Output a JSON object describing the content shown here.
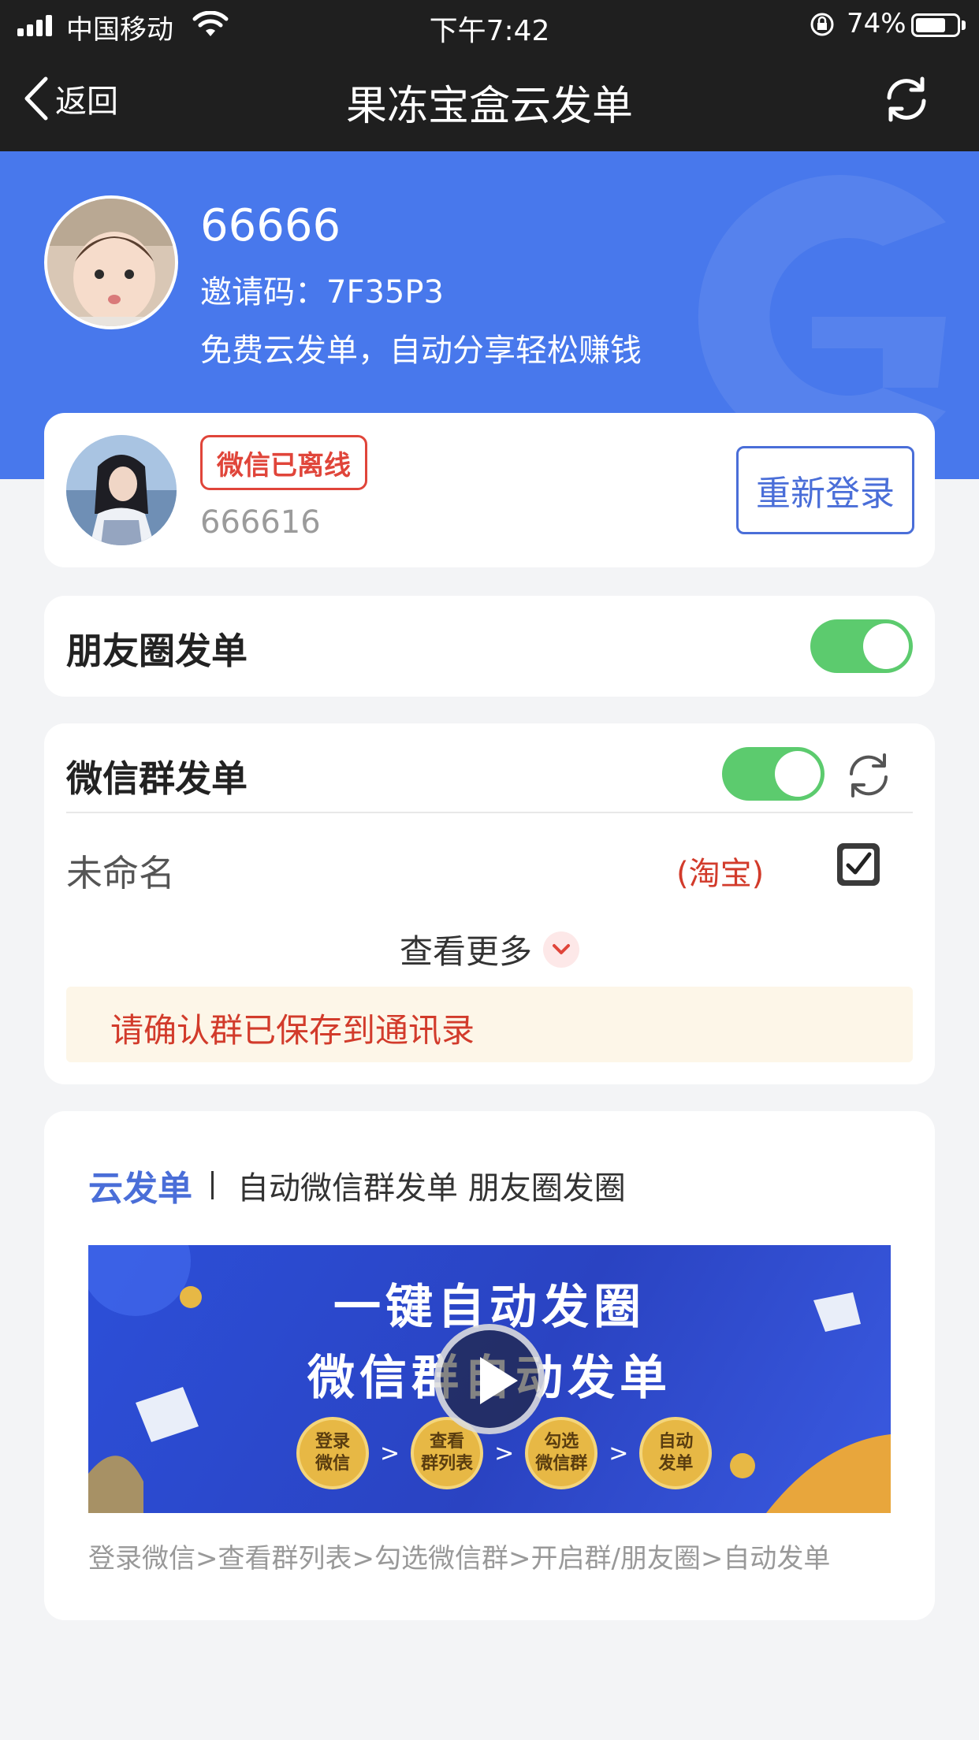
{
  "status_bar": {
    "carrier": "中国移动",
    "time": "下午7:42",
    "battery_percent": "74%",
    "battery_level": 0.74
  },
  "nav": {
    "back_label": "返回",
    "title": "果冻宝盒云发单",
    "refresh_icon": "refresh-icon"
  },
  "profile": {
    "name": "66666",
    "invite_code": "邀请码：7F35P3",
    "slogan": "免费云发单，自动分享轻松赚钱"
  },
  "wechat_account": {
    "status_badge": "微信已离线",
    "account_id": "666616",
    "relogin_label": "重新登录"
  },
  "moments": {
    "title": "朋友圈发单",
    "enabled": true
  },
  "groups": {
    "title": "微信群发单",
    "enabled": true,
    "items": [
      {
        "name": "未命名",
        "tag": "(淘宝)",
        "checked": true
      }
    ],
    "view_more_label": "查看更多",
    "notice": "请确认群已保存到通讯录"
  },
  "intro": {
    "brand": "云发单",
    "description": "自动微信群发单 朋友圈发圈",
    "video": {
      "line1": "一键自动发圈",
      "line2": "微信群自动发单",
      "steps": [
        "登录\n微信",
        "查看\n群列表",
        "勾选\n微信群",
        "自动\n发单"
      ],
      "step_separator": ">"
    },
    "steps_text": "登录微信>查看群列表>勾选微信群>开启群/朋友圈>自动发单"
  },
  "colors": {
    "header_blue": "#4878ec",
    "toggle_green": "#5ccb6e",
    "alert_red": "#e0453a",
    "link_blue": "#4a6ed8"
  }
}
